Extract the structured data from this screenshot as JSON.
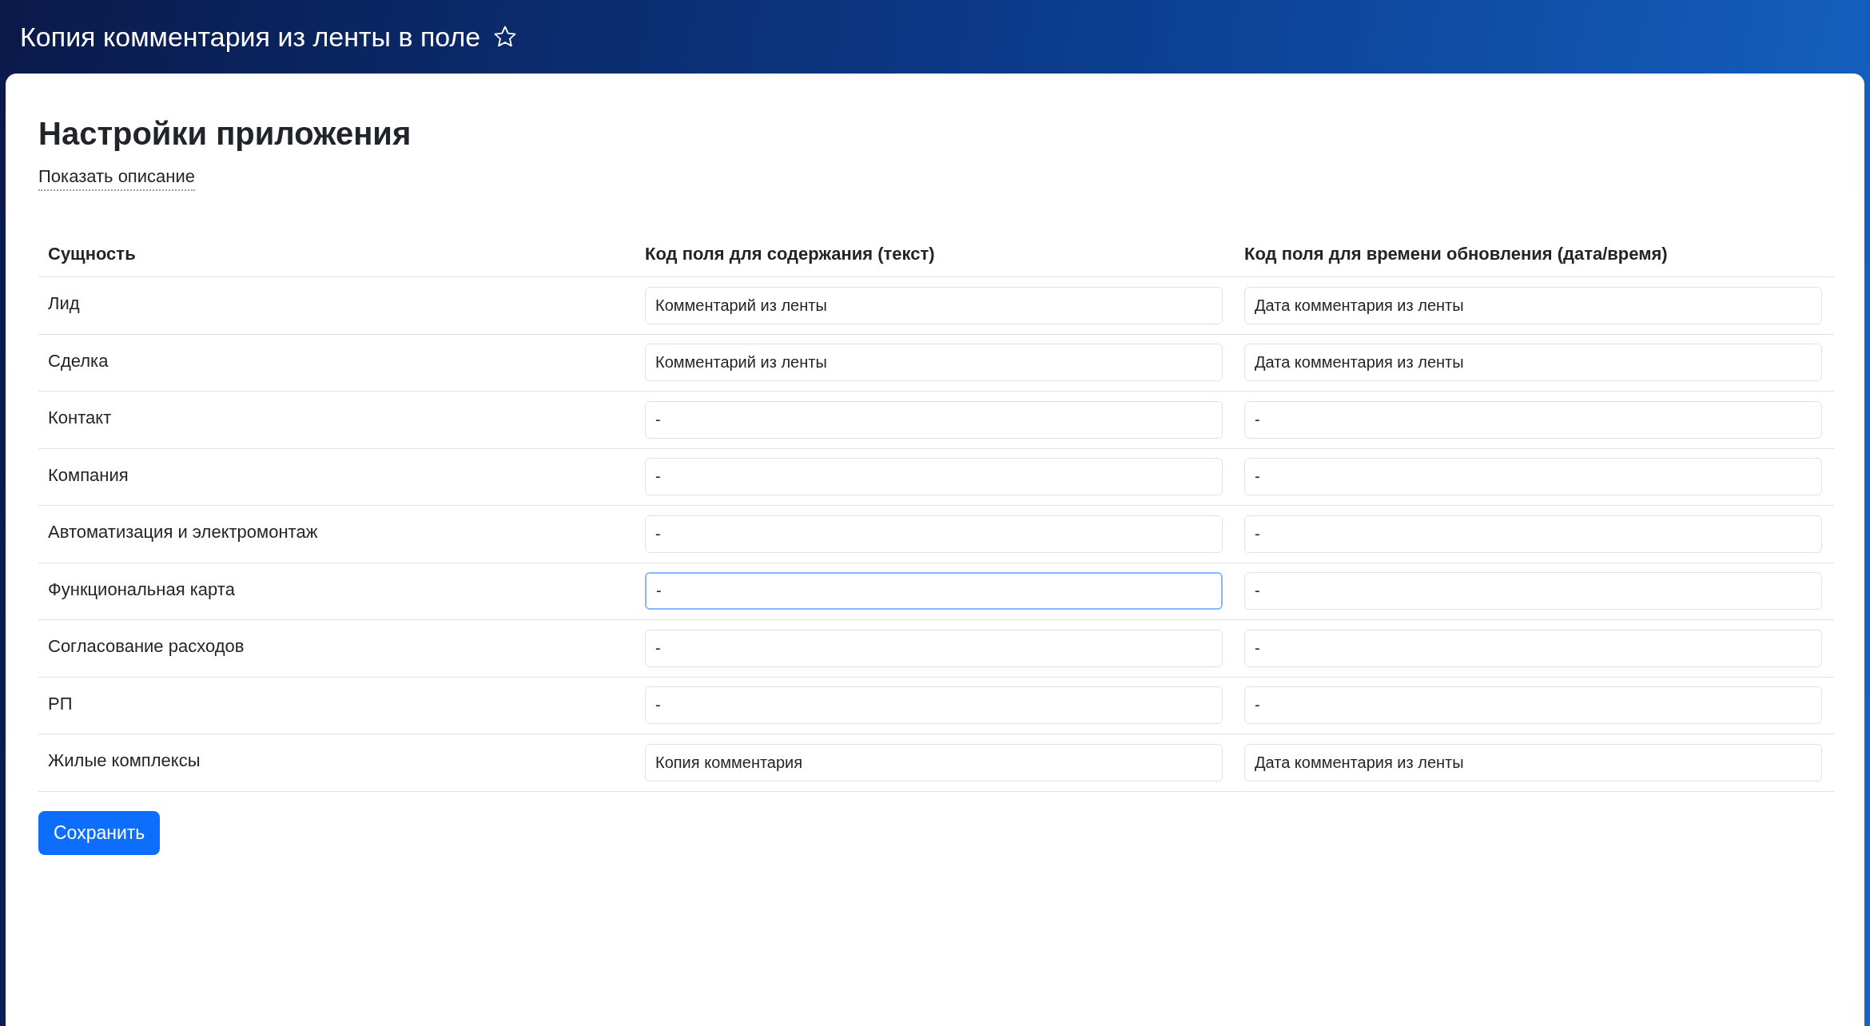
{
  "page": {
    "title": "Копия комментария из ленты в поле",
    "favorite": false
  },
  "settings": {
    "heading": "Настройки приложения",
    "description_link": "Показать описание",
    "table": {
      "columns": [
        "Сущность",
        "Код поля для содержания (текст)",
        "Код поля для времени обновления (дата/время)"
      ],
      "rows": [
        {
          "entity": "Лид",
          "content_field": {
            "value": "Комментарий из ленты",
            "focused": false
          },
          "time_field": {
            "value": "Дата комментария из ленты",
            "focused": false
          }
        },
        {
          "entity": "Сделка",
          "content_field": {
            "value": "Комментарий из ленты",
            "focused": false
          },
          "time_field": {
            "value": "Дата комментария из ленты",
            "focused": false
          }
        },
        {
          "entity": "Контакт",
          "content_field": {
            "value": "-",
            "focused": false
          },
          "time_field": {
            "value": "-",
            "focused": false
          }
        },
        {
          "entity": "Компания",
          "content_field": {
            "value": "-",
            "focused": false
          },
          "time_field": {
            "value": "-",
            "focused": false
          }
        },
        {
          "entity": "Автоматизация и электромонтаж",
          "content_field": {
            "value": "-",
            "focused": false
          },
          "time_field": {
            "value": "-",
            "focused": false
          }
        },
        {
          "entity": "Функциональная карта",
          "content_field": {
            "value": "-",
            "focused": true
          },
          "time_field": {
            "value": "-",
            "focused": false
          }
        },
        {
          "entity": "Согласование расходов",
          "content_field": {
            "value": "-",
            "focused": false
          },
          "time_field": {
            "value": "-",
            "focused": false
          }
        },
        {
          "entity": "РП",
          "content_field": {
            "value": "-",
            "focused": false
          },
          "time_field": {
            "value": "-",
            "focused": false
          }
        },
        {
          "entity": "Жилые комплексы",
          "content_field": {
            "value": "Копия комментария",
            "focused": false
          },
          "time_field": {
            "value": "Дата комментария из ленты",
            "focused": false
          }
        }
      ]
    },
    "save_button": "Сохранить"
  }
}
